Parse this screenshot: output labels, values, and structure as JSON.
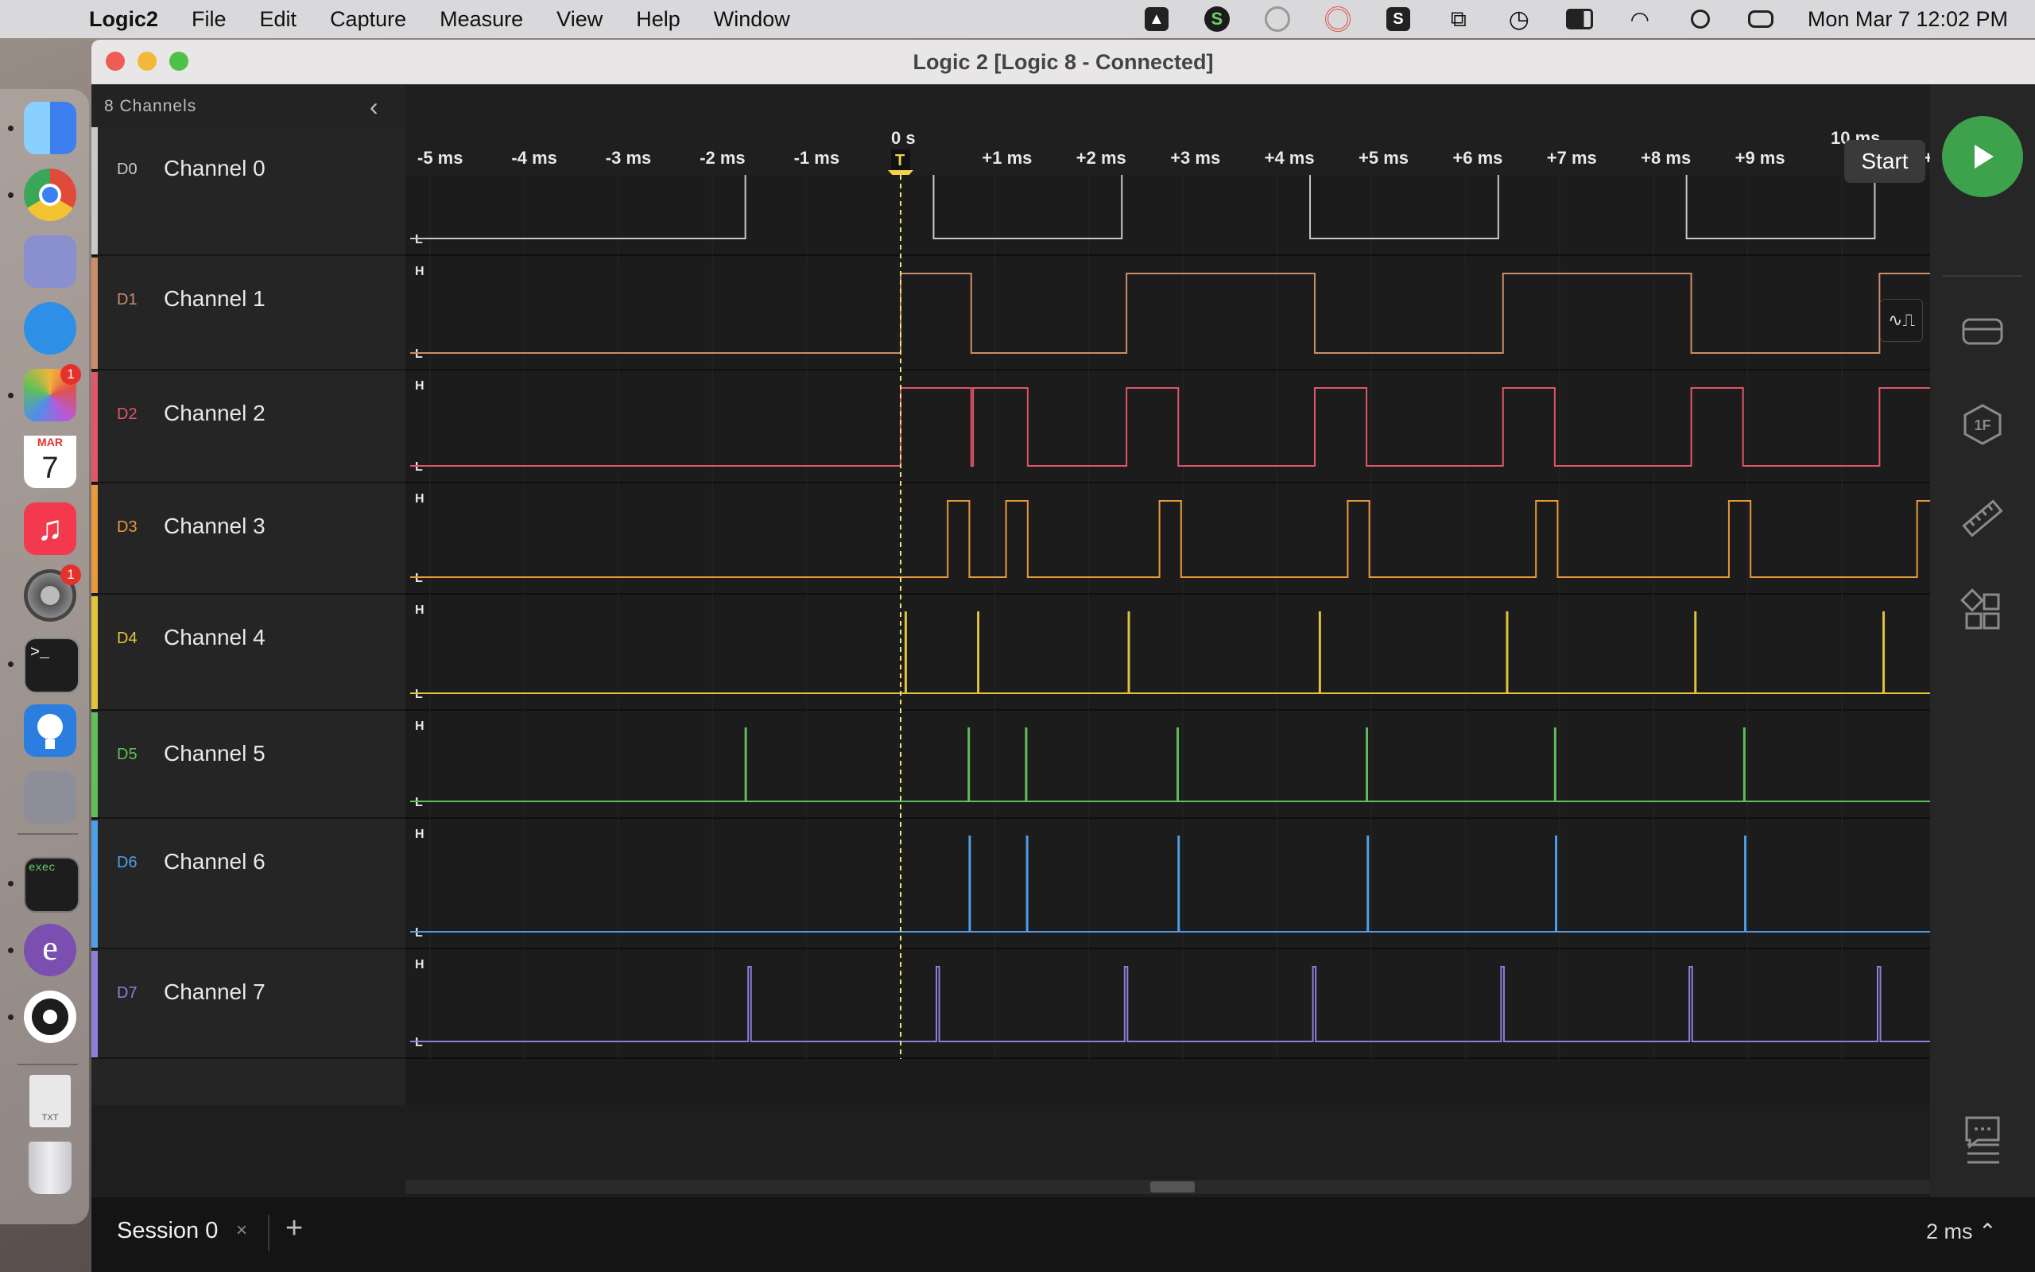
{
  "menubar": {
    "app_name": "Logic2",
    "items": [
      "File",
      "Edit",
      "Capture",
      "Measure",
      "View",
      "Help",
      "Window"
    ],
    "clock": "Mon Mar 7  12:02 PM",
    "status_icons": [
      "drive-icon",
      "stripe-icon",
      "tool-icon",
      "antenna-icon",
      "scrivener-icon",
      "binoculars-icon",
      "time-machine-icon",
      "battery-icon",
      "wifi-icon",
      "spotlight-icon",
      "control-center-icon"
    ]
  },
  "dock": {
    "apps": [
      {
        "name": "finder-icon",
        "color": "#3e9bf0",
        "running": true
      },
      {
        "name": "chrome-icon",
        "color": "#e04a3b",
        "running": true
      },
      {
        "name": "launchpad-icon",
        "color": "#8a8fd0",
        "running": false
      },
      {
        "name": "safari-icon",
        "color": "#2d8fe6",
        "running": false
      },
      {
        "name": "photos-icon",
        "color": "#f2b43a",
        "running": true,
        "badge": "1"
      },
      {
        "name": "calendar-icon",
        "color": "#ffffff",
        "running": false,
        "month": "MAR",
        "day": "7"
      },
      {
        "name": "music-icon",
        "color": "#f2394d",
        "running": false
      },
      {
        "name": "system-preferences-icon",
        "color": "#7a7a7a",
        "running": false,
        "badge": "1"
      },
      {
        "name": "terminal-icon",
        "color": "#1d1d1d",
        "running": true
      },
      {
        "name": "logic-icon",
        "color": "#2b7de0",
        "running": false
      },
      {
        "name": "photo-slideshow-icon",
        "color": "#8e8e9a",
        "running": false
      },
      {
        "name": "exec-icon",
        "color": "#1d1d1d",
        "running": true,
        "label": "exec"
      },
      {
        "name": "emacs-icon",
        "color": "#7a4fb0",
        "running": true
      },
      {
        "name": "obs-icon",
        "color": "#1d1d1d",
        "running": true
      },
      {
        "name": "text-file-icon",
        "color": "#e8e8e8",
        "running": false,
        "label": "TXT"
      },
      {
        "name": "trash-icon",
        "color": "#d5d5d8",
        "running": false
      }
    ]
  },
  "window": {
    "title": "Logic 2 [Logic 8 - Connected]"
  },
  "channels_panel": {
    "count_label": "8 Channels",
    "channels": [
      {
        "id": "D0",
        "name": "Channel 0",
        "color": "#c8c8c8"
      },
      {
        "id": "D1",
        "name": "Channel 1",
        "color": "#c98d6a"
      },
      {
        "id": "D2",
        "name": "Channel 2",
        "color": "#e0566a"
      },
      {
        "id": "D3",
        "name": "Channel 3",
        "color": "#e89a3c"
      },
      {
        "id": "D4",
        "name": "Channel 4",
        "color": "#e0c43a"
      },
      {
        "id": "D5",
        "name": "Channel 5",
        "color": "#5fbf5a"
      },
      {
        "id": "D6",
        "name": "Channel 6",
        "color": "#4f9fe8"
      },
      {
        "id": "D7",
        "name": "Channel 7",
        "color": "#8d7fd8"
      }
    ]
  },
  "timeline": {
    "zero_label": "0 s",
    "major_label": "10 ms",
    "trigger_label": "T",
    "ticks": [
      "-5 ms",
      "-4 ms",
      "-3 ms",
      "-2 ms",
      "-1 ms",
      "",
      "+1 ms",
      "+2 ms",
      "+3 ms",
      "+4 ms",
      "+5 ms",
      "+6 ms",
      "+7 ms",
      "+8 ms",
      "+9 ms",
      "",
      "+"
    ],
    "high_label": "H",
    "low_label": "L"
  },
  "signals": {
    "D0": {
      "initial": 0,
      "edges_ms": [
        -1.65,
        0.35,
        2.35,
        4.35,
        6.35,
        8.35,
        10.35
      ]
    },
    "D1": {
      "initial": 0,
      "edges_ms": [
        0.0,
        0.75,
        2.4,
        4.4,
        6.4,
        8.4,
        10.4
      ]
    },
    "D2": {
      "initial": 0,
      "edges_ms": [
        0.0,
        0.75,
        0.77,
        1.35,
        2.4,
        2.95,
        4.4,
        4.95,
        6.4,
        6.95,
        8.4,
        8.95,
        10.4,
        10.95
      ]
    },
    "D3": {
      "initial": 0,
      "edges_ms": [
        0.5,
        0.73,
        1.12,
        1.35,
        2.75,
        2.98,
        4.75,
        4.98,
        6.75,
        6.98,
        8.8,
        9.03,
        10.8,
        11.0
      ]
    },
    "D4": {
      "pulses_ms": [
        0.05,
        0.82,
        2.42,
        4.45,
        6.44,
        8.44,
        10.44
      ]
    },
    "D5": {
      "pulses_ms": [
        -1.65,
        0.72,
        1.33,
        2.94,
        4.95,
        6.95,
        8.96,
        10.97
      ]
    },
    "D6": {
      "pulses_ms": [
        0.73,
        1.34,
        2.95,
        4.96,
        6.96,
        8.97,
        10.98
      ]
    },
    "D7": {
      "pulses_ms": [
        -1.62,
        0.38,
        2.38,
        4.38,
        6.38,
        8.38,
        10.38
      ],
      "width_ms": 0.03
    }
  },
  "right_toolbar": {
    "start_tooltip": "Start",
    "icons": [
      "start-icon",
      "device-icon",
      "analyzers-icon",
      "measurements-icon",
      "extensions-icon",
      "feedback-icon",
      "menu-icon"
    ],
    "trigger_mode_glyph": "∿⎍",
    "analyzer_glyph": "1F"
  },
  "bottombar": {
    "session_label": "Session 0",
    "close_glyph": "×",
    "add_glyph": "+",
    "zoom_level": "2 ms ⌃"
  }
}
